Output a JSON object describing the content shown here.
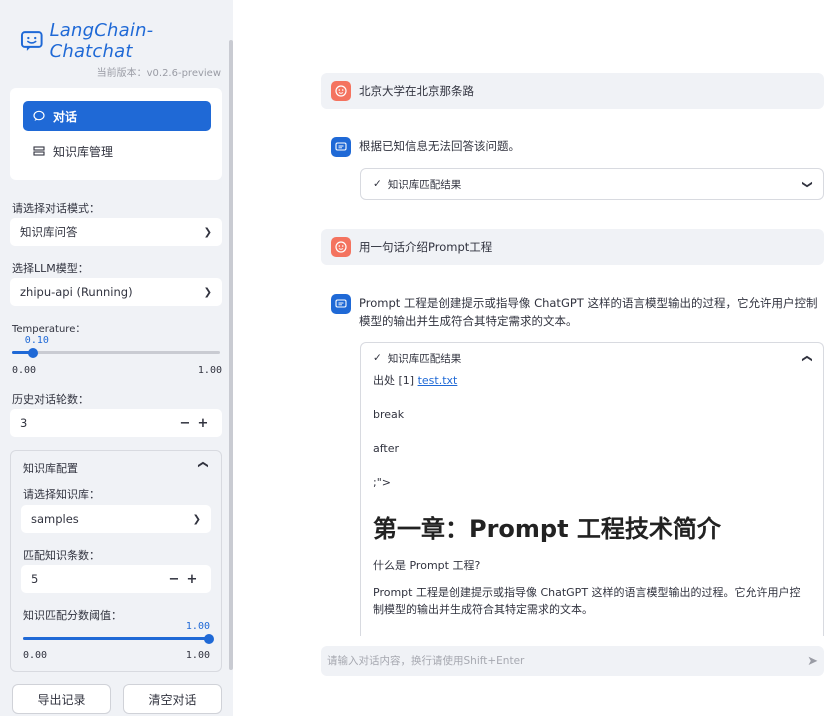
{
  "app": {
    "title": "LangChain-Chatchat",
    "version": "当前版本：v0.2.6-preview"
  },
  "nav": {
    "items": [
      {
        "label": "对话",
        "active": true
      },
      {
        "label": "知识库管理",
        "active": false
      }
    ]
  },
  "settings": {
    "mode_label": "请选择对话模式：",
    "mode_value": "知识库问答",
    "llm_label": "选择LLM模型：",
    "llm_value": "zhipu-api (Running)",
    "temperature": {
      "label": "Temperature：",
      "value": "0.10",
      "fraction": 0.1,
      "min": "0.00",
      "max": "1.00"
    },
    "history": {
      "label": "历史对话轮数：",
      "value": "3"
    },
    "kb_config": {
      "title": "知识库配置",
      "kb_label": "请选择知识库：",
      "kb_value": "samples",
      "topk_label": "匹配知识条数：",
      "topk_value": "5",
      "threshold_label": "知识匹配分数阈值：",
      "threshold_value": "1.00",
      "threshold_fraction": 1.0,
      "threshold_min": "0.00",
      "threshold_max": "1.00"
    }
  },
  "actions": {
    "export": "导出记录",
    "clear": "清空对话"
  },
  "chat": {
    "messages": [
      {
        "role": "user",
        "text": "北京大学在北京那条路"
      },
      {
        "role": "assistant",
        "text": "根据已知信息无法回答该问题。",
        "expander": "知识库匹配结果"
      },
      {
        "role": "user",
        "text": "用一句话介绍Prompt工程"
      },
      {
        "role": "assistant",
        "text": "Prompt 工程是创建提示或指导像 ChatGPT 这样的语言模型输出的过程，它允许用户控制模型的输出并生成符合其特定需求的文本。",
        "expander": "知识库匹配结果"
      }
    ],
    "source": {
      "prefix": "出处 [1]",
      "link": "test.txt",
      "lines": [
        "break",
        "after",
        ";\">"
      ],
      "heading": "第一章：Prompt 工程技术简介",
      "question": "什么是 Prompt 工程?",
      "para": "Prompt 工程是创建提示或指导像 ChatGPT 这样的语言模型输出的过程。它允许用户控制模型的输出并生成符合其特定需求的文本。"
    },
    "input_placeholder": "请输入对话内容，换行请使用Shift+Enter"
  },
  "colors": {
    "accent": "#1f69d6",
    "user_avatar": "#f4735f",
    "sidebar_bg": "#f0f2f6"
  }
}
